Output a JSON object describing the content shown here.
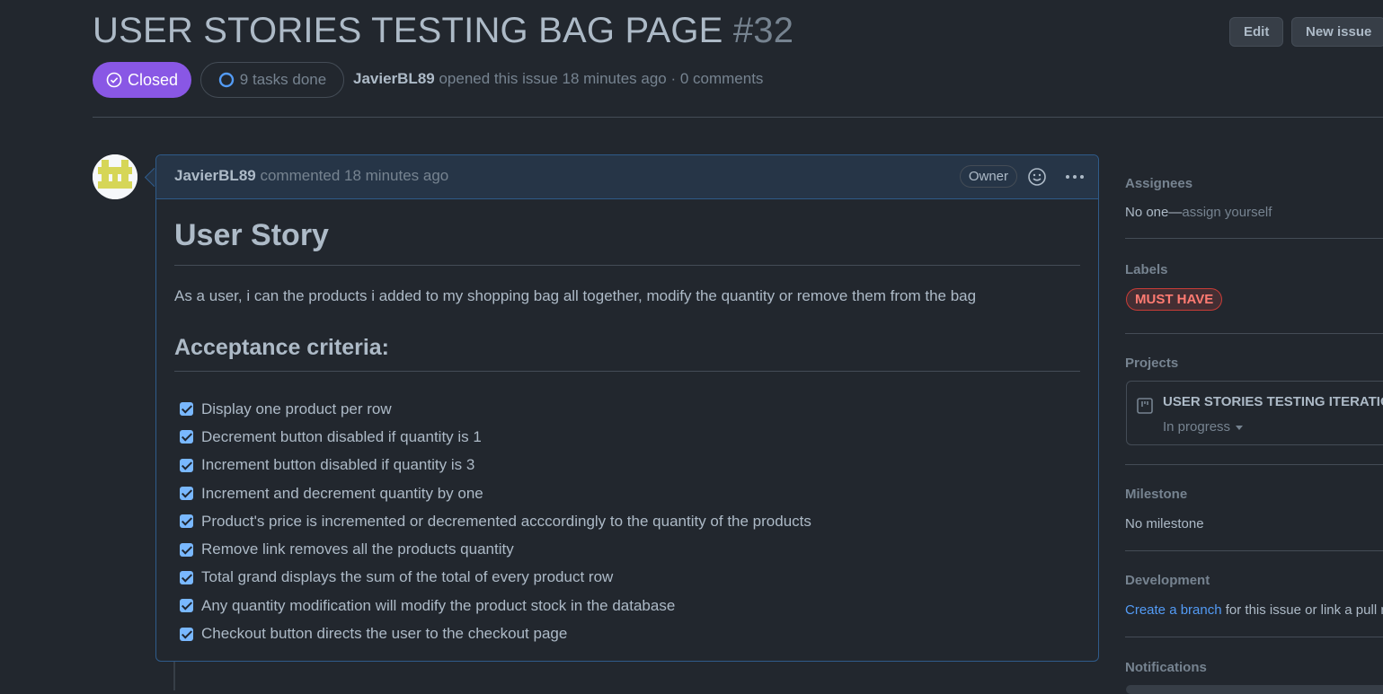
{
  "issue": {
    "title": "USER STORIES TESTING BAG PAGE",
    "number": "#32",
    "state": "Closed",
    "tasks_done": "9 tasks done",
    "author": "JavierBL89",
    "meta_text": " opened this issue 18 minutes ago · 0 comments"
  },
  "header_buttons": {
    "edit": "Edit",
    "new_issue": "New issue"
  },
  "comment": {
    "author": "JavierBL89",
    "time_text": " commented 18 minutes ago",
    "owner_badge": "Owner",
    "heading": "User Story",
    "paragraph": "As a user, i can the products i added to my shopping bag all together, modify the quantity or remove them from the bag",
    "subheading": "Acceptance criteria:",
    "tasks": [
      {
        "text": "Display one product per row",
        "checked": true
      },
      {
        "text": "Decrement button disabled if quantity is 1",
        "checked": true
      },
      {
        "text": "Increment button disabled if quantity is 3",
        "checked": true
      },
      {
        "text": "Increment and decrement quantity by one",
        "checked": true
      },
      {
        "text": "Product's price is incremented or decremented acccordingly to the quantity of the products",
        "checked": true
      },
      {
        "text": "Remove link removes all the products quantity",
        "checked": true
      },
      {
        "text": "Total grand displays the sum of the total of every product row",
        "checked": true
      },
      {
        "text": "Any quantity modification will modify the product stock in the database",
        "checked": true
      },
      {
        "text": "Checkout button directs the user to the checkout page",
        "checked": true
      }
    ]
  },
  "sidebar": {
    "assignees": {
      "heading": "Assignees",
      "value": "No one—",
      "action": "assign yourself"
    },
    "labels": {
      "heading": "Labels",
      "items": [
        "MUST HAVE"
      ]
    },
    "projects": {
      "heading": "Projects",
      "name": "USER STORIES TESTING ITERATION",
      "status": "In progress"
    },
    "milestone": {
      "heading": "Milestone",
      "value": "No milestone"
    },
    "development": {
      "heading": "Development",
      "link": "Create a branch",
      "text": " for this issue or link a pull r"
    },
    "notifications": {
      "heading": "Notifications"
    }
  },
  "colors": {
    "background": "#22272e",
    "closed_purple": "#8957e5",
    "label_red": "#ff7b72",
    "link_blue": "#539bf5",
    "checkbox_blue": "#79b8ff"
  },
  "icons": [
    "check-circle-icon",
    "progress-circle-icon",
    "smiley-icon",
    "kebab-icon",
    "project-board-icon",
    "caret-down-icon",
    "checkbox-icon"
  ]
}
